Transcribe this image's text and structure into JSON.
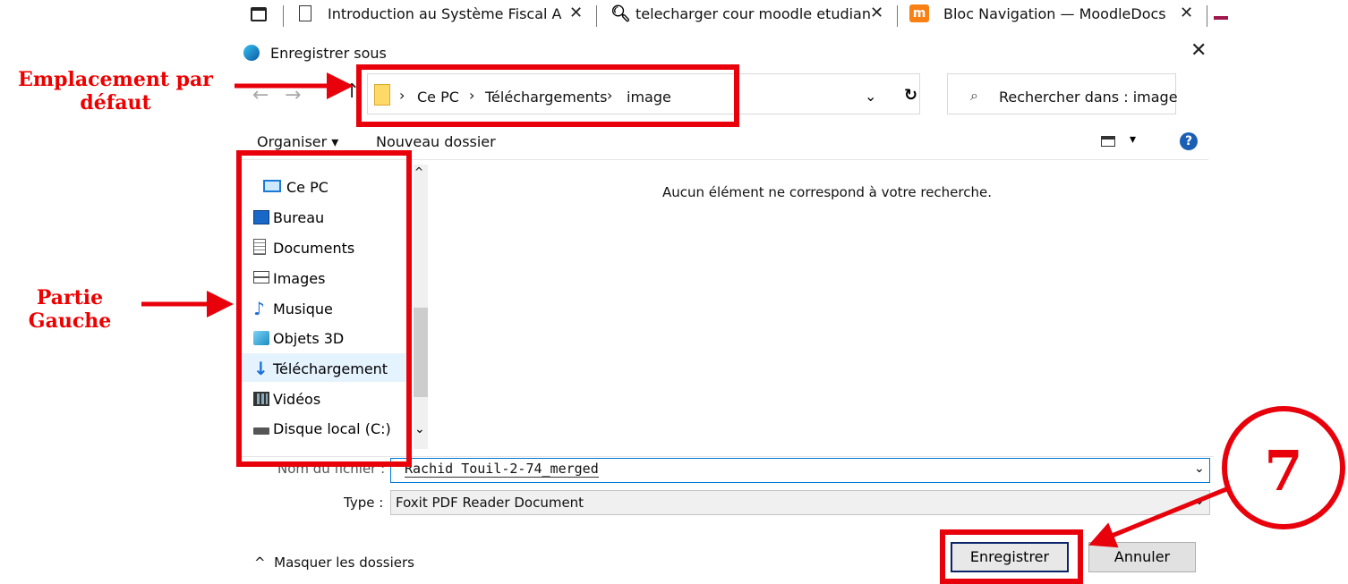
{
  "browser": {
    "tabs": [
      {
        "label": "Introduction au Système Fiscal A"
      },
      {
        "label": "telecharger cour moodle etudian"
      },
      {
        "label": "Bloc Navigation — MoodleDocs"
      }
    ]
  },
  "dialog": {
    "title": "Enregistrer sous",
    "breadcrumb": [
      "Ce PC",
      "Téléchargements",
      "image"
    ],
    "search_placeholder": "Rechercher dans : image",
    "toolbar": {
      "organize": "Organiser",
      "new_folder": "Nouveau dossier"
    },
    "empty_message": "Aucun élément ne correspond à votre recherche.",
    "nav_items": [
      {
        "label": "Ce PC",
        "icon": "computer-icon"
      },
      {
        "label": "Bureau",
        "icon": "desktop-icon"
      },
      {
        "label": "Documents",
        "icon": "documents-icon"
      },
      {
        "label": "Images",
        "icon": "images-icon"
      },
      {
        "label": "Musique",
        "icon": "music-icon"
      },
      {
        "label": "Objets 3D",
        "icon": "objects-3d-icon"
      },
      {
        "label": "Téléchargement",
        "icon": "downloads-icon"
      },
      {
        "label": "Vidéos",
        "icon": "videos-icon"
      },
      {
        "label": "Disque local (C:)",
        "icon": "drive-icon"
      }
    ],
    "filename_label": "Nom du fichier :",
    "filename_value": "Rachid Touil-2-74_merged",
    "type_label": "Type :",
    "type_value": "Foxit PDF Reader Document",
    "hide_folders": "Masquer les dossiers",
    "save_button": "Enregistrer",
    "cancel_button": "Annuler"
  },
  "annotations": {
    "default_location": [
      "Emplacement par",
      "défaut"
    ],
    "left_part": [
      "Partie",
      "Gauche"
    ],
    "step_number": "7"
  },
  "colors": {
    "annotation_red": "#e8000b",
    "accent_blue": "#0078d7",
    "selected_bg": "#cce8ff"
  }
}
